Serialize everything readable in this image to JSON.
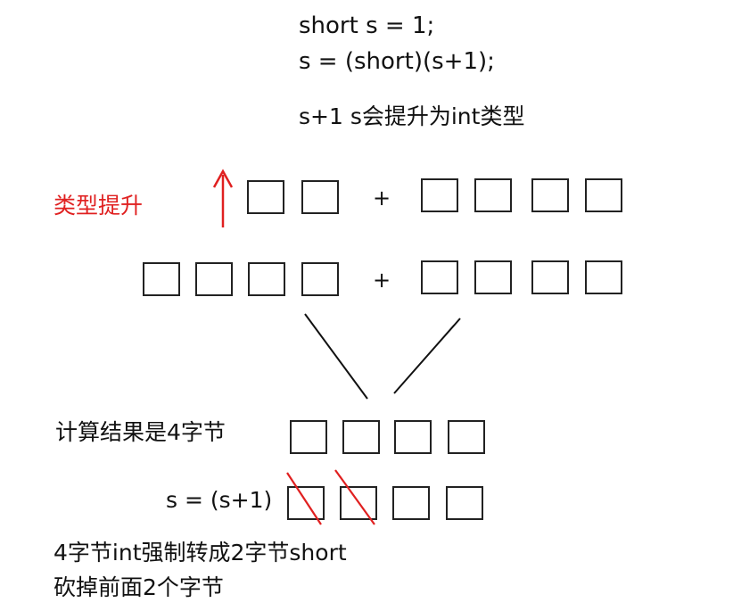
{
  "code": {
    "line1": "short s = 1;",
    "line2": "s = (short)(s+1);"
  },
  "note_promote": "s+1  s会提升为int类型",
  "label_promotion": "类型提升",
  "plus_symbol": "+",
  "label_result": "计算结果是4字节",
  "label_assign": "s = (s+1)",
  "note_cast_line1": "4字节int强制转成2字节short",
  "note_cast_line2": "砍掉前面2个字节",
  "colors": {
    "red": "#e02020",
    "ink": "#222222"
  },
  "icons": {
    "up_arrow": "up-arrow-icon"
  }
}
